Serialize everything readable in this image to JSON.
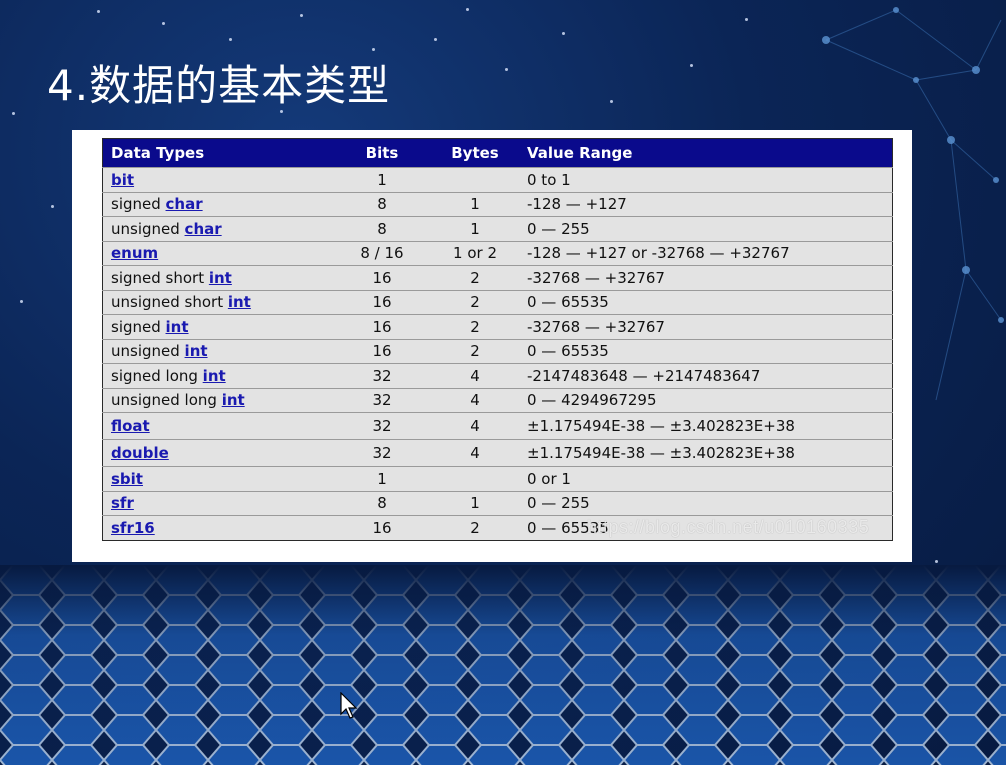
{
  "slide": {
    "title": "4.数据的基本类型"
  },
  "table": {
    "headers": [
      "Data Types",
      "Bits",
      "Bytes",
      "Value Range"
    ],
    "rows": [
      {
        "prefix": "",
        "keyword": "bit",
        "bits": "1",
        "bytes": "",
        "range": "0 to 1"
      },
      {
        "prefix": "signed ",
        "keyword": "char",
        "bits": "8",
        "bytes": "1",
        "range": "-128 — +127"
      },
      {
        "prefix": "unsigned ",
        "keyword": "char",
        "bits": "8",
        "bytes": "1",
        "range": "0 — 255"
      },
      {
        "prefix": "",
        "keyword": "enum",
        "bits": "8 / 16",
        "bytes": "1 or 2",
        "range": "-128 — +127 or -32768 — +32767"
      },
      {
        "prefix": "signed short ",
        "keyword": "int",
        "bits": "16",
        "bytes": "2",
        "range": "-32768 — +32767"
      },
      {
        "prefix": "unsigned short ",
        "keyword": "int",
        "bits": "16",
        "bytes": "2",
        "range": "0 — 65535"
      },
      {
        "prefix": "signed ",
        "keyword": "int",
        "bits": "16",
        "bytes": "2",
        "range": "-32768 — +32767"
      },
      {
        "prefix": "unsigned ",
        "keyword": "int",
        "bits": "16",
        "bytes": "2",
        "range": "0 — 65535"
      },
      {
        "prefix": "signed long ",
        "keyword": "int",
        "bits": "32",
        "bytes": "4",
        "range": "-2147483648 — +2147483647"
      },
      {
        "prefix": "unsigned long ",
        "keyword": "int",
        "bits": "32",
        "bytes": "4",
        "range": "0 — 4294967295"
      },
      {
        "prefix": "",
        "keyword": "float",
        "bits": "32",
        "bytes": "4",
        "range": "±1.175494E-38 — ±3.402823E+38"
      },
      {
        "prefix": "",
        "keyword": "double",
        "bits": "32",
        "bytes": "4",
        "range": "±1.175494E-38 — ±3.402823E+38"
      },
      {
        "prefix": "",
        "keyword": "sbit",
        "bits": "1",
        "bytes": "",
        "range": "0 or 1"
      },
      {
        "prefix": "",
        "keyword": "sfr",
        "bits": "8",
        "bytes": "1",
        "range": "0 — 255"
      },
      {
        "prefix": "",
        "keyword": "sfr16",
        "bits": "16",
        "bytes": "2",
        "range": "0 — 65535"
      }
    ]
  },
  "watermark": "https://blog.csdn.net/u010160335",
  "colors": {
    "header_bg": "#0a0a8c",
    "row_bg": "#e3e3e3",
    "link": "#1a1ab0"
  }
}
